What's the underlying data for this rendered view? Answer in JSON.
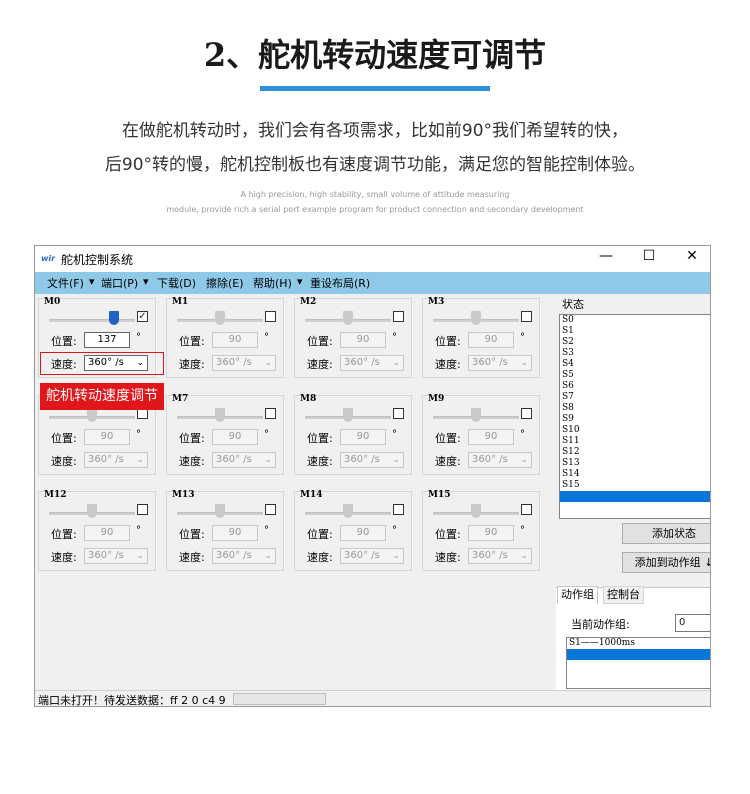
{
  "page": {
    "title": "2、舵机转动速度可调节",
    "intro_line1": "在做舵机转动时，我们会有各项需求，比如前90°我们希望转的快，",
    "intro_line2": "后90°转的慢，舵机控制板也有速度调节功能，满足您的智能控制体验。",
    "eng_line1": "A high precision, high stability, small volume of attitude measuring",
    "eng_line2": "module, provide rich a serial port example program for product connection and secondary development",
    "accent_color": "#2f8fd8"
  },
  "window": {
    "title": "舵机控制系统",
    "icon": "app-logo-icon",
    "controls": {
      "minimize": "—",
      "maximize": "☐",
      "close": "✕"
    },
    "menu": [
      {
        "label": "文件(F)"
      },
      {
        "label": "端口(P)"
      },
      {
        "label": "下载(D)"
      },
      {
        "label": "擦除(E)"
      },
      {
        "label": "帮助(H)"
      },
      {
        "label": "重设布局(R)"
      }
    ],
    "menu_bar_color": "#8ec9e8"
  },
  "servo_labels": {
    "position": "位置:",
    "speed": "速度:",
    "degree": "°"
  },
  "servos": [
    {
      "name": "M0",
      "position": "137",
      "speed": "360° /s",
      "checked": true,
      "active": true,
      "slider": 0.76
    },
    {
      "name": "M1",
      "position": "90",
      "speed": "360° /s",
      "checked": false,
      "active": false,
      "slider": 0.5
    },
    {
      "name": "M2",
      "position": "90",
      "speed": "360° /s",
      "checked": false,
      "active": false,
      "slider": 0.5
    },
    {
      "name": "M3",
      "position": "90",
      "speed": "360° /s",
      "checked": false,
      "active": false,
      "slider": 0.5
    },
    {
      "name": "",
      "position": "90",
      "speed": "360° /s",
      "checked": false,
      "active": false,
      "slider": 0.5
    },
    {
      "name": "M7",
      "position": "90",
      "speed": "360° /s",
      "checked": false,
      "active": false,
      "slider": 0.5
    },
    {
      "name": "M8",
      "position": "90",
      "speed": "360° /s",
      "checked": false,
      "active": false,
      "slider": 0.5
    },
    {
      "name": "M9",
      "position": "90",
      "speed": "360° /s",
      "checked": false,
      "active": false,
      "slider": 0.5
    },
    {
      "name": "M12",
      "position": "90",
      "speed": "360° /s",
      "checked": false,
      "active": false,
      "slider": 0.5
    },
    {
      "name": "M13",
      "position": "90",
      "speed": "360° /s",
      "checked": false,
      "active": false,
      "slider": 0.5
    },
    {
      "name": "M14",
      "position": "90",
      "speed": "360° /s",
      "checked": false,
      "active": false,
      "slider": 0.5
    },
    {
      "name": "M15",
      "position": "90",
      "speed": "360° /s",
      "checked": false,
      "active": false,
      "slider": 0.5
    }
  ],
  "highlight": {
    "label": "舵机转动速度调节",
    "color": "#e0161b"
  },
  "state_panel": {
    "label": "状态",
    "items": [
      "S0",
      "S1",
      "S2",
      "S3",
      "S4",
      "S5",
      "S6",
      "S7",
      "S8",
      "S9",
      "S10",
      "S11",
      "S12",
      "S13",
      "S14",
      "S15"
    ],
    "add_state_button": "添加状态",
    "add_to_group_button": "添加到动作组 ↓"
  },
  "tabs": [
    {
      "label": "动作组",
      "active": true
    },
    {
      "label": "控制台",
      "active": false
    }
  ],
  "action_group": {
    "current_label": "当前动作组:",
    "current_value": "0",
    "items": [
      "S1——1000ms"
    ]
  },
  "status_bar": {
    "text": "端口未打开！待发送数据：ff 2 0 c4 9"
  }
}
